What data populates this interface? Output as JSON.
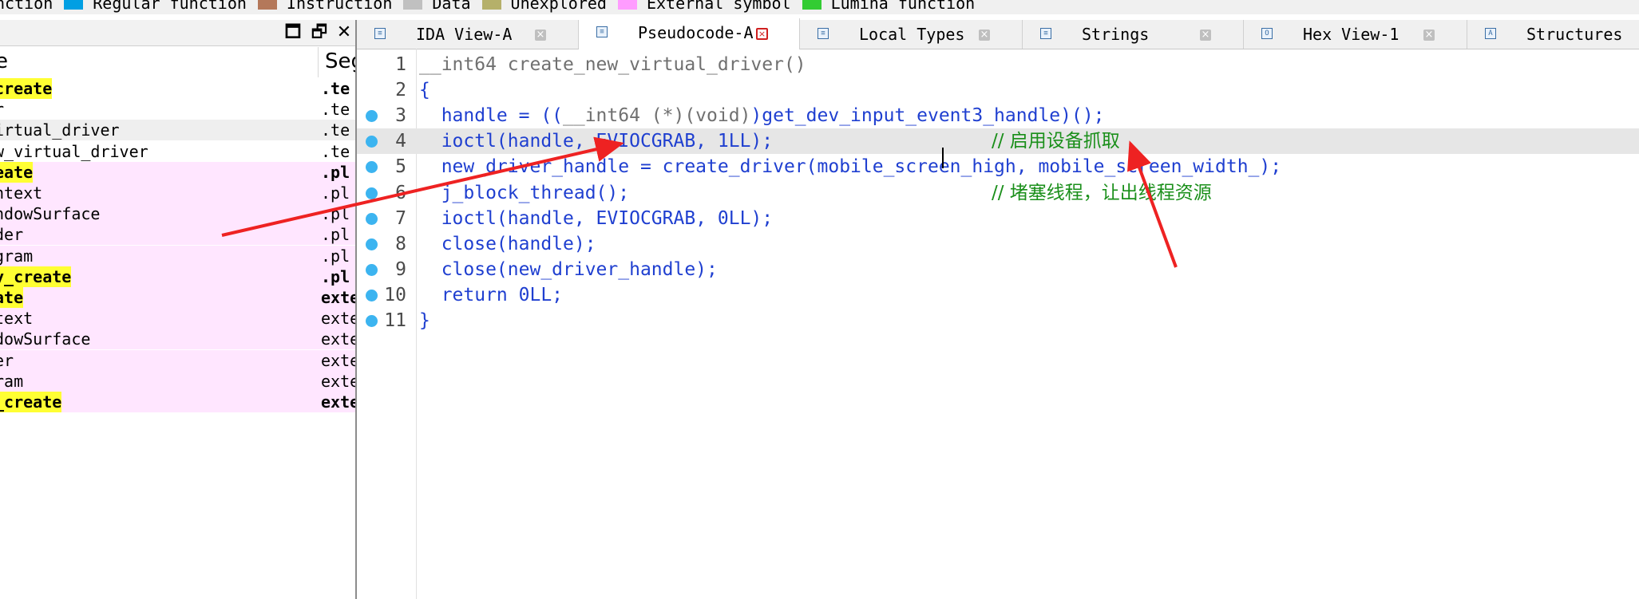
{
  "legend": [
    {
      "label": "nction",
      "color": ""
    },
    {
      "label": "Regular function",
      "color": "#009fe3"
    },
    {
      "label": "Instruction",
      "color": "#b4785a"
    },
    {
      "label": "Data",
      "color": "#c0c0c0"
    },
    {
      "label": "Unexplored",
      "color": "#b5b06a"
    },
    {
      "label": "External symbol",
      "color": "#ff9cff"
    },
    {
      "label": "Lumina function",
      "color": "#33cc33"
    }
  ],
  "functions_pane": {
    "controls": {
      "maximize": "🗖",
      "restore": "🗗",
      "close": "✕"
    },
    "columns": {
      "name": "e",
      "segment": "Seg"
    },
    "rows": [
      {
        "name": "create",
        "segment": ".te",
        "highlight": true,
        "bg": "#ffffff",
        "bold": true
      },
      {
        "name": "r",
        "segment": ".te",
        "highlight": false,
        "bg": "#ffffff",
        "bold": false
      },
      {
        "name": "irtual_driver",
        "segment": ".te",
        "highlight": false,
        "bg": "#efefef",
        "bold": false
      },
      {
        "name": "w_virtual_driver",
        "segment": ".te",
        "highlight": false,
        "bg": "#ffffff",
        "bold": false
      },
      {
        "name": "eate",
        "segment": ".pl",
        "highlight": true,
        "bg": "#ffe6ff",
        "bold": true
      },
      {
        "name": "ntext",
        "segment": ".pl",
        "highlight": false,
        "bg": "#ffe6ff",
        "bold": false
      },
      {
        "name": "ndowSurface",
        "segment": ".pl",
        "highlight": false,
        "bg": "#ffe6ff",
        "bold": false
      },
      {
        "name": "der",
        "segment": ".pl",
        "highlight": false,
        "bg": "#ffe6ff",
        "bold": false
      },
      {
        "name": "gram",
        "segment": ".pl",
        "highlight": false,
        "bg": "#ffe6ff",
        "bold": false
      },
      {
        "name": "y_create",
        "segment": ".pl",
        "highlight": true,
        "bg": "#ffe6ff",
        "bold": true
      },
      {
        "name": "ate",
        "segment": "exte",
        "highlight": true,
        "bg": "#ffe6ff",
        "bold": true
      },
      {
        "name": "text",
        "segment": "exte",
        "highlight": false,
        "bg": "#ffe6ff",
        "bold": false
      },
      {
        "name": "dowSurface",
        "segment": "exte",
        "highlight": false,
        "bg": "#ffe6ff",
        "bold": false
      },
      {
        "name": "er",
        "segment": "exte",
        "highlight": false,
        "bg": "#ffe6ff",
        "bold": false
      },
      {
        "name": "ram",
        "segment": "exte",
        "highlight": false,
        "bg": "#ffe6ff",
        "bold": false
      },
      {
        "name": "_create",
        "segment": "exte",
        "highlight": true,
        "bg": "#ffe6ff",
        "bold": true
      }
    ]
  },
  "tabs": [
    {
      "label": "IDA View-A",
      "icon": "≡",
      "active": false
    },
    {
      "label": "Pseudocode-A",
      "icon": "≡",
      "active": true
    },
    {
      "label": "Local Types",
      "icon": "≡",
      "active": false
    },
    {
      "label": "Strings",
      "icon": "≡",
      "active": false
    },
    {
      "label": "Hex View-1",
      "icon": "O",
      "active": false
    },
    {
      "label": "Structures",
      "icon": "A",
      "active": false
    }
  ],
  "tab_close_glyph": "×",
  "code": {
    "lines": [
      {
        "num": "1",
        "dot": false,
        "current": false,
        "parts": [
          [
            "__int64 create_new_virtual_driver()",
            "gray"
          ]
        ],
        "comment": ""
      },
      {
        "num": "2",
        "dot": false,
        "current": false,
        "parts": [
          [
            "{",
            "kw"
          ]
        ],
        "comment": ""
      },
      {
        "num": "3",
        "dot": true,
        "current": false,
        "parts": [
          [
            "  handle = ((",
            "kw"
          ],
          [
            "__int64 (*)(void)",
            "gray"
          ],
          [
            ")get_dev_input_event3_handle)();",
            "kw"
          ]
        ],
        "comment": ""
      },
      {
        "num": "4",
        "dot": true,
        "current": true,
        "parts": [
          [
            "  ioctl(handle, EVIOCGRAB, 1LL);",
            "kw"
          ]
        ],
        "comment": "// 启用设备抓取"
      },
      {
        "num": "5",
        "dot": true,
        "current": false,
        "parts": [
          [
            "  new_driver_handle = create_driver(mobile_screen_high, mobile_screen_width_);",
            "kw"
          ]
        ],
        "comment": ""
      },
      {
        "num": "6",
        "dot": true,
        "current": false,
        "parts": [
          [
            "  j_block_thread();",
            "kw"
          ]
        ],
        "comment": "// 堵塞线程，让出线程资源"
      },
      {
        "num": "7",
        "dot": true,
        "current": false,
        "parts": [
          [
            "  ioctl(handle, EVIOCGRAB, 0LL);",
            "kw"
          ]
        ],
        "comment": ""
      },
      {
        "num": "8",
        "dot": true,
        "current": false,
        "parts": [
          [
            "  close(handle);",
            "kw"
          ]
        ],
        "comment": ""
      },
      {
        "num": "9",
        "dot": true,
        "current": false,
        "parts": [
          [
            "  close(new_driver_handle);",
            "kw"
          ]
        ],
        "comment": ""
      },
      {
        "num": "10",
        "dot": true,
        "current": false,
        "parts": [
          [
            "  return 0LL;",
            "kw"
          ]
        ],
        "comment": ""
      },
      {
        "num": "11",
        "dot": true,
        "current": false,
        "parts": [
          [
            "}",
            "kw"
          ]
        ],
        "comment": ""
      }
    ]
  }
}
